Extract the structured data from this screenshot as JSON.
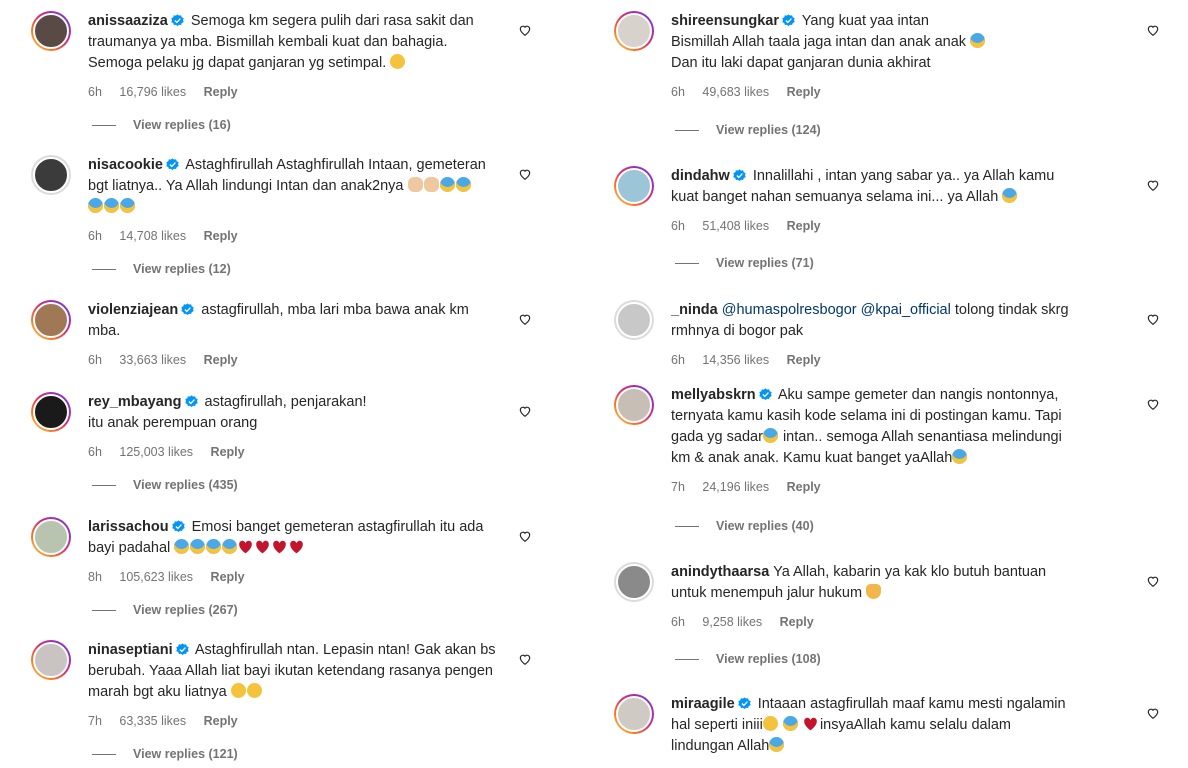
{
  "left_comments": [
    {
      "username": "anissaaziza",
      "verified": true,
      "text_lines": [
        "Semoga km segera pulih dari rasa sakit dan",
        "traumanya ya mba. Bismillah kembali kuat dan bahagia.",
        "Semoga pelaku jg dapat ganjaran yg setimpal."
      ],
      "emojis": [
        "pleading"
      ],
      "time": "6h",
      "likes": "16,796 likes",
      "reply": "Reply",
      "view_replies": "View replies (16)"
    },
    {
      "username": "nisacookie",
      "verified": true,
      "text_lines": [
        "Astaghfirullah Astaghfirullah Intaan, gemeteran",
        "bgt liatnya.. Ya Allah lindungi Intan dan anak2nya"
      ],
      "time": "6h",
      "likes": "14,708 likes",
      "reply": "Reply",
      "view_replies": "View replies (12)"
    },
    {
      "username": "violenziajean",
      "verified": true,
      "text_lines": [
        "astagfirullah, mba lari mba bawa anak km",
        "mba."
      ],
      "time": "6h",
      "likes": "33,663 likes",
      "reply": "Reply"
    },
    {
      "username": "rey_mbayang",
      "verified": true,
      "text_lines": [
        "astagfirullah, penjarakan!",
        "itu anak perempuan orang"
      ],
      "time": "6h",
      "likes": "125,003 likes",
      "reply": "Reply",
      "view_replies": "View replies (435)"
    },
    {
      "username": "larissachou",
      "verified": true,
      "text_lines": [
        "Emosi banget gemeteran astagfirullah itu ada",
        "bayi padahal"
      ],
      "time": "8h",
      "likes": "105,623 likes",
      "reply": "Reply",
      "view_replies": "View replies (267)"
    },
    {
      "username": "ninaseptiani",
      "verified": true,
      "text_lines": [
        "Astaghfirullah ntan. Lepasin ntan! Gak akan bs",
        "berubah. Yaaa Allah liat bayi ikutan ketendang rasanya pengen",
        "marah bgt aku liatnya"
      ],
      "time": "7h",
      "likes": "63,335 likes",
      "reply": "Reply",
      "view_replies": "View replies (121)"
    }
  ],
  "right_comments": [
    {
      "username": "shireensungkar",
      "verified": true,
      "text_lines": [
        "Yang kuat yaa intan",
        "Bismillah Allah taala jaga intan dan anak anak",
        "Dan itu laki dapat ganjaran dunia akhirat"
      ],
      "time": "6h",
      "likes": "49,683 likes",
      "reply": "Reply",
      "view_replies": "View replies (124)"
    },
    {
      "username": "dindahw",
      "verified": true,
      "text_lines": [
        "Innalillahi , intan yang sabar ya.. ya Allah kamu",
        "kuat banget nahan semuanya selama ini... ya Allah"
      ],
      "time": "6h",
      "likes": "51,408 likes",
      "reply": "Reply",
      "view_replies": "View replies (71)"
    },
    {
      "username": "_ninda",
      "verified": false,
      "mentions": [
        "@humaspolresbogor",
        "@kpai_official"
      ],
      "text_lines": [
        "tolong tindak skrg",
        "rmhnya di bogor pak"
      ],
      "time": "6h",
      "likes": "14,356 likes",
      "reply": "Reply"
    },
    {
      "username": "mellyabskrn",
      "verified": true,
      "text_lines": [
        "Aku sampe gemeter dan nangis nontonnya,",
        "ternyata kamu kasih kode selama ini di postingan kamu. Tapi",
        "gada yg sadar",
        "intan.. semoga Allah senantiasa melindungi",
        "km & anak anak. Kamu kuat banget yaAllah"
      ],
      "time": "7h",
      "likes": "24,196 likes",
      "reply": "Reply",
      "view_replies": "View replies (40)"
    },
    {
      "username": "anindythaarsa",
      "verified": false,
      "text_lines": [
        "Ya Allah, kabarin ya kak klo butuh bantuan",
        "untuk menempuh jalur hukum"
      ],
      "time": "6h",
      "likes": "9,258 likes",
      "reply": "Reply",
      "view_replies": "View replies (108)"
    },
    {
      "username": "miraagile",
      "verified": true,
      "text_lines": [
        "Intaaan astagfirullah maaf kamu mesti ngalamin",
        "hal seperti iniii",
        "insyaAllah kamu selalu dalam",
        "lindungan Allah"
      ]
    }
  ],
  "colors": {
    "link": "#00376b",
    "muted": "#737373",
    "text": "#262626",
    "verified": "#0095f6"
  },
  "icons": {
    "like": "heart-outline-icon",
    "verified": "verified-badge-icon"
  }
}
